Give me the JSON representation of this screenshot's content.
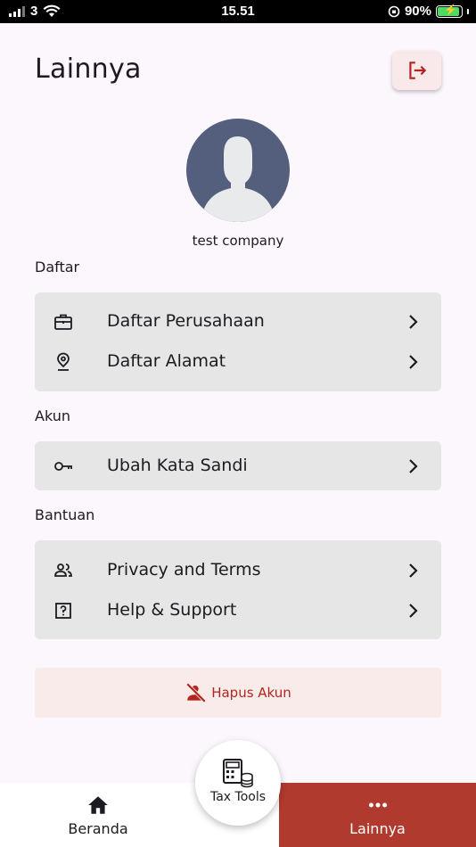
{
  "status_bar": {
    "carrier": "3",
    "time": "15.51",
    "battery": "90%"
  },
  "header": {
    "title": "Lainnya"
  },
  "profile": {
    "company_name": "test company"
  },
  "sections": {
    "daftar": {
      "label": "Daftar",
      "items": [
        {
          "label": "Daftar Perusahaan",
          "icon": "briefcase-icon"
        },
        {
          "label": "Daftar Alamat",
          "icon": "location-pin-icon"
        }
      ]
    },
    "akun": {
      "label": "Akun",
      "items": [
        {
          "label": "Ubah Kata Sandi",
          "icon": "key-icon"
        }
      ]
    },
    "bantuan": {
      "label": "Bantuan",
      "items": [
        {
          "label": "Privacy and Terms",
          "icon": "people-icon"
        },
        {
          "label": "Help & Support",
          "icon": "question-box-icon"
        }
      ]
    }
  },
  "delete_account": {
    "label": "Hapus Akun"
  },
  "bottom_nav": {
    "home": {
      "label": "Beranda"
    },
    "tax_tools": {
      "label": "Tax Tools"
    },
    "more": {
      "label": "Lainnya"
    }
  },
  "colors": {
    "accent": "#b03a2e",
    "background": "#fcf6fd",
    "card": "#e6e6e6",
    "danger": "#b3261e"
  }
}
